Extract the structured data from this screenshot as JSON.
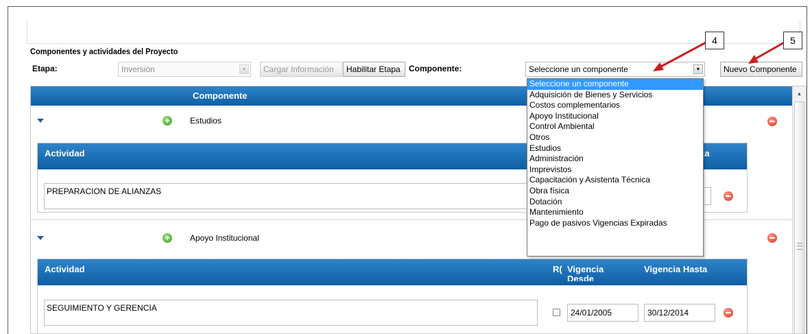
{
  "section_title": "Componentes y actividades del Proyecto",
  "etapa": {
    "label": "Etapa:",
    "value": "Inversión"
  },
  "buttons": {
    "cargar": "Cargar Información",
    "habilitar": "Habilitar Etapa",
    "nuevo": "Nuevo Componente"
  },
  "componente": {
    "label": "Componente:",
    "value": "Seleccione un componente"
  },
  "grid": {
    "header": "Componente"
  },
  "dropdown_options": [
    "Seleccione un componente",
    "Adquisición de Bienes y Servicios",
    "Costos complementarios",
    "Apoyo Institucional",
    "Control Ambiental",
    "Otros",
    "Estudios",
    "Administración",
    "Imprevistos",
    "Capacitación y Asistenta Técnica",
    "Obra física",
    "Dotación",
    "Mantenimiento",
    "Pago de pasivos Vigencias Expiradas"
  ],
  "components": [
    {
      "name": "Estudios",
      "activity_header": "Actividad",
      "partial_header": "ta",
      "activity": "PREPARACION DE ALIANZAS"
    },
    {
      "name": "Apoyo Institucional",
      "activity_header": "Actividad",
      "col_rc": "R(",
      "col_desde": "Vigencia Desde",
      "col_hasta": "Vigencia Hasta",
      "activity": "SEGUIMIENTO Y GERENCIA",
      "desde": "24/01/2005",
      "hasta": "30/12/2014"
    }
  ],
  "callouts": [
    "4",
    "5"
  ],
  "colors": {
    "header_top": "#2f83c8",
    "header_bottom": "#0e5ea5",
    "selected": "#3399ff",
    "arrow": "#cc1f1f"
  },
  "icons": [
    "expand-arrow-icon",
    "add-icon",
    "remove-icon",
    "dropdown-arrow-icon",
    "scroll-up-icon"
  ]
}
